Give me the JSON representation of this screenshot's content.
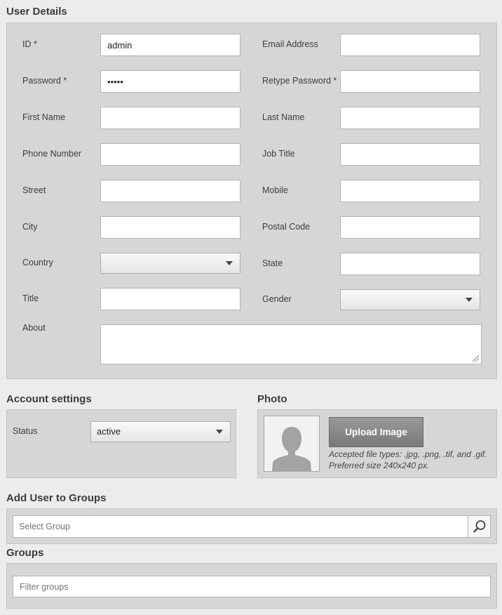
{
  "user_details": {
    "title": "User Details",
    "fields": {
      "id": {
        "label": "ID *",
        "value": "admin"
      },
      "email": {
        "label": "Email Address",
        "value": ""
      },
      "password": {
        "label": "Password *",
        "value": "•••••"
      },
      "retype_password": {
        "label": "Retype Password *",
        "value": ""
      },
      "first_name": {
        "label": "First Name",
        "value": ""
      },
      "last_name": {
        "label": "Last Name",
        "value": ""
      },
      "phone": {
        "label": "Phone Number",
        "value": ""
      },
      "job_title": {
        "label": "Job Title",
        "value": ""
      },
      "street": {
        "label": "Street",
        "value": ""
      },
      "mobile": {
        "label": "Mobile",
        "value": ""
      },
      "city": {
        "label": "City",
        "value": ""
      },
      "postal_code": {
        "label": "Postal Code",
        "value": ""
      },
      "country": {
        "label": "Country",
        "value": ""
      },
      "state": {
        "label": "State",
        "value": ""
      },
      "title_field": {
        "label": "Title",
        "value": ""
      },
      "gender": {
        "label": "Gender",
        "value": ""
      },
      "about": {
        "label": "About",
        "value": ""
      }
    }
  },
  "account_settings": {
    "title": "Account settings",
    "status_label": "Status",
    "status_value": "active"
  },
  "photo": {
    "title": "Photo",
    "upload_label": "Upload Image",
    "hint_line1": "Accepted file types: .jpg, .png, .tif, and .gif.",
    "hint_line2": "Preferred size 240x240 px."
  },
  "add_to_groups": {
    "title": "Add User to Groups",
    "placeholder": "Select Group"
  },
  "groups": {
    "title": "Groups",
    "placeholder": "Filter groups"
  },
  "icons": {
    "search": "search-icon",
    "dropdown": "chevron-down-icon",
    "avatar": "user-silhouette-icon",
    "resize": "resize-grip-icon"
  },
  "colors": {
    "page_bg": "#ececec",
    "panel_bg": "#d6d6d6",
    "upload_button": "#8a8a8a"
  }
}
